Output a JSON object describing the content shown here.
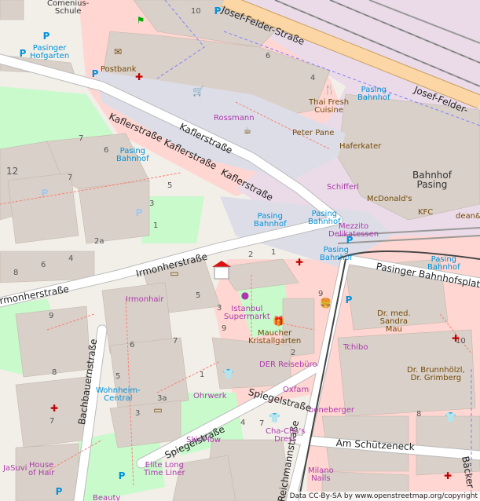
{
  "streets": [
    {
      "id": "josef-felder-1",
      "text": "Josef-Felder-Straße"
    },
    {
      "id": "josef-felder-2",
      "text": "Josef-Felder-"
    },
    {
      "id": "kafler-1",
      "text": "Kaflerstraße"
    },
    {
      "id": "kafler-2",
      "text": "Kaflerstraße"
    },
    {
      "id": "kafler-3",
      "text": "Kaflerstraße"
    },
    {
      "id": "kafler-4",
      "text": "Kaflerstraße"
    },
    {
      "id": "irmonher-1",
      "text": "Irmonherstraße"
    },
    {
      "id": "irmonher-2",
      "text": "Irmonherstraße"
    },
    {
      "id": "bachbauern",
      "text": "Bachbauernstraße"
    },
    {
      "id": "spiegel-1",
      "text": "Spiegelstraße"
    },
    {
      "id": "spiegel-2",
      "text": "Spiegelstraße"
    },
    {
      "id": "pasinger-bp",
      "text": "Pasinger Bahnhofsplatz"
    },
    {
      "id": "schuetzeneck",
      "text": "Am Schützeneck"
    },
    {
      "id": "reichmann",
      "text": "Reichmannstraße"
    },
    {
      "id": "baecker",
      "text": "Bäcker"
    }
  ],
  "pois": [
    {
      "id": "comenius",
      "text": "Comenius-\nSchule",
      "color": "dark"
    },
    {
      "id": "pasinger-hofgarten",
      "text": "Pasinger\nHofgarten",
      "color": "blue"
    },
    {
      "id": "postbank",
      "text": "Postbank",
      "color": "brown"
    },
    {
      "id": "rossmann",
      "text": "Rossmann",
      "color": "purple"
    },
    {
      "id": "thai-fresh",
      "text": "Thai Fresh\nCuisine",
      "color": "brown"
    },
    {
      "id": "peter-pane",
      "text": "Peter Pane",
      "color": "brown"
    },
    {
      "id": "pasing-bahnhof-1",
      "text": "Pasing\nBahnhof",
      "color": "blue"
    },
    {
      "id": "pasing-bahnhof-2",
      "text": "Pasing\nBahnhof",
      "color": "blue"
    },
    {
      "id": "pasing-bahnhof-3",
      "text": "Pasing\nBahnhof",
      "color": "blue"
    },
    {
      "id": "pasing-bahnhof-4",
      "text": "Pasing\nBahnhof",
      "color": "blue"
    },
    {
      "id": "pasing-bahnhof-5",
      "text": "Pasing\nBahnhof",
      "color": "blue"
    },
    {
      "id": "pasing-bahnhof-6",
      "text": "Pasing\nBahnhof",
      "color": "blue"
    },
    {
      "id": "pasing-bahnhof-7",
      "text": "Pasing\nBahnhof",
      "color": "blue"
    },
    {
      "id": "haferkater",
      "text": "Haferkater",
      "color": "brown"
    },
    {
      "id": "bahnhof-pasing",
      "text": "Bahnhof\nPasing",
      "color": "dark"
    },
    {
      "id": "schifferl",
      "text": "Schifferl",
      "color": "purple"
    },
    {
      "id": "mcdonalds",
      "text": "McDonald's",
      "color": "brown"
    },
    {
      "id": "kfc",
      "text": "KFC",
      "color": "brown"
    },
    {
      "id": "dean",
      "text": "dean&",
      "color": "brown"
    },
    {
      "id": "mezzito",
      "text": "Mezzito\nDelikatessen",
      "color": "purple"
    },
    {
      "id": "irmonhair",
      "text": "Irmonhair",
      "color": "purple"
    },
    {
      "id": "istanbul",
      "text": "Istanbul\nSupermarkt",
      "color": "purple"
    },
    {
      "id": "maucher",
      "text": "Maucher\nKristallgarten",
      "color": "brown"
    },
    {
      "id": "dr-sandra",
      "text": "Dr. med.\nSandra\nMau",
      "color": "brown"
    },
    {
      "id": "tchibo",
      "text": "Tchibo",
      "color": "purple"
    },
    {
      "id": "der-reisebuero",
      "text": "DER Reisebüro",
      "color": "purple"
    },
    {
      "id": "oxfam",
      "text": "Oxfam",
      "color": "purple"
    },
    {
      "id": "dr-brunn",
      "text": "Dr. Brunnhölzl,\nDr. Grimberg",
      "color": "brown"
    },
    {
      "id": "wohnheim",
      "text": "Wohnheim-\nCentral",
      "color": "blue"
    },
    {
      "id": "ohrwerk",
      "text": "Ohrwerk",
      "color": "purple"
    },
    {
      "id": "boneberger",
      "text": "boneberger",
      "color": "purple"
    },
    {
      "id": "cha-chas",
      "text": "Cha-Cha's\nDress",
      "color": "purple"
    },
    {
      "id": "skinflow",
      "text": "SkinFlow",
      "color": "purple"
    },
    {
      "id": "house-of-hair",
      "text": "House\nof Hair",
      "color": "purple"
    },
    {
      "id": "jasuvi",
      "text": "JaSuvi",
      "color": "purple"
    },
    {
      "id": "elite-long",
      "text": "Elite Long\nTime Liner",
      "color": "purple"
    },
    {
      "id": "beauty",
      "text": "Beauty",
      "color": "purple"
    },
    {
      "id": "milano-nails",
      "text": "Milano\nNails",
      "color": "purple"
    }
  ],
  "house_numbers": [
    "10",
    "6",
    "4",
    "7",
    "6",
    "7",
    "12",
    "5",
    "3",
    "2a",
    "1",
    "8",
    "6",
    "4",
    "2",
    "1",
    "3",
    "9",
    "6",
    "7",
    "9",
    "8",
    "7",
    "5",
    "3",
    "3a",
    "1",
    "10",
    "9",
    "2",
    "4",
    "5",
    "7",
    "8"
  ],
  "attribution": "Data CC-By-SA by www.openstreetmap.org/copyright",
  "colors": {
    "land": "#f2efe9",
    "building": "#d9d0c9",
    "retail": "#ffd6d1",
    "railway_area": "#ebdbe8",
    "park": "#c8facc",
    "road": "#ffffff",
    "secondary": "#f7fabf",
    "primary": "#fcd6a4",
    "pedestrian": "#dddde8",
    "railway": "#999999",
    "footway": "#fa8072"
  }
}
